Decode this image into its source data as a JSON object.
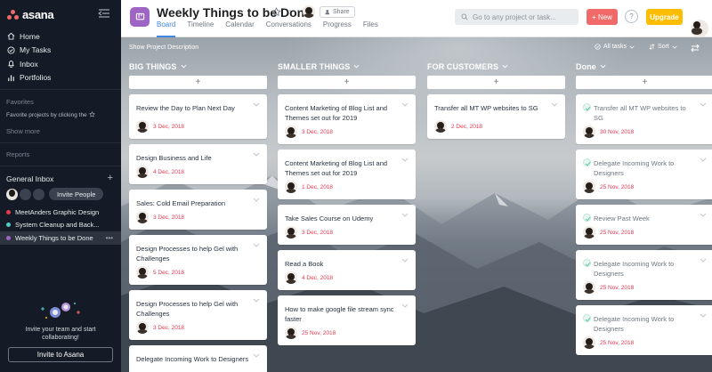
{
  "app": {
    "name": "asana"
  },
  "sidebar": {
    "nav": [
      {
        "label": "Home",
        "icon": "home-icon"
      },
      {
        "label": "My Tasks",
        "icon": "check-circle-icon"
      },
      {
        "label": "Inbox",
        "icon": "bell-icon"
      },
      {
        "label": "Portfolios",
        "icon": "bar-chart-icon"
      }
    ],
    "favorites_label": "Favorites",
    "favorites_note": "Favorite projects by clicking the",
    "show_more": "Show more",
    "reports_label": "Reports",
    "team": {
      "name": "General Inbox",
      "invite_label": "Invite People"
    },
    "projects": [
      {
        "name": "MeetAnders Graphic Design",
        "color": "#e8384f",
        "active": false
      },
      {
        "name": "System Cleanup and Back...",
        "color": "#4ecbc4",
        "active": false
      },
      {
        "name": "Weekly Things to be Done",
        "color": "#9e65c4",
        "active": true
      }
    ],
    "invite_text_1": "Invite your team and start",
    "invite_text_2": "collaborating!",
    "invite_button": "Invite to Asana"
  },
  "header": {
    "title": "Weekly Things to be Done",
    "share_label": "Share",
    "tabs": [
      "Board",
      "Timeline",
      "Calendar",
      "Conversations",
      "Progress",
      "Files"
    ],
    "active_tab": "Board",
    "search_placeholder": "Go to any project or task...",
    "new_label": "New",
    "help_label": "?",
    "upgrade_label": "Upgrade"
  },
  "board": {
    "show_description": "Show Project Description",
    "filter_label": "All tasks",
    "sort_label": "Sort",
    "add_symbol": "+",
    "columns": [
      {
        "name": "BIG THINGS",
        "cards": [
          {
            "title": "Review the Day to Plan Next Day",
            "date": "3 Dec, 2018"
          },
          {
            "title": "Design Business and Life",
            "date": "4 Dec, 2018"
          },
          {
            "title": "Sales: Cold Email Preparation",
            "date": "3 Dec, 2018"
          },
          {
            "title": "Design Processes to help Gel with Challenges",
            "date": "5 Dec, 2018"
          },
          {
            "title": "Design Processes to help Gel with Challenges",
            "date": "3 Dec, 2018"
          },
          {
            "title": "Delegate Incoming Work to Designers",
            "date": ""
          }
        ]
      },
      {
        "name": "SMALLER THINGS",
        "cards": [
          {
            "title": "Content Marketing of Blog List and Themes set out for 2019",
            "date": "3 Dec, 2018"
          },
          {
            "title": "Content Marketing of Blog List and Themes set out for 2019",
            "date": "1 Dec, 2018"
          },
          {
            "title": "Take Sales Course on Udemy",
            "date": "3 Dec, 2018"
          },
          {
            "title": "Read a Book",
            "date": "4 Dec, 2018"
          },
          {
            "title": "How to make google file stream sync faster",
            "date": "25 Nov, 2018"
          }
        ]
      },
      {
        "name": "FOR CUSTOMERS",
        "cards": [
          {
            "title": "Transfer all MT WP websites to SG",
            "date": "2 Dec, 2018"
          }
        ]
      },
      {
        "name": "Done",
        "cards": [
          {
            "title": "Transfer all MT WP websites to SG",
            "date": "30 Nov, 2018"
          },
          {
            "title": "Delegate Incoming Work to Designers",
            "date": "25 Nov, 2018"
          },
          {
            "title": "Review Past Week",
            "date": "25 Nov, 2018"
          },
          {
            "title": "Delegate Incoming Work to Designers",
            "date": "25 Nov, 2018"
          },
          {
            "title": "Delegate Incoming Work to Designers",
            "date": "25 Nov, 2018"
          }
        ]
      }
    ]
  }
}
